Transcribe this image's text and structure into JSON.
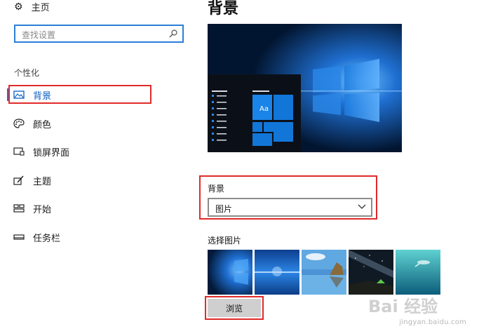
{
  "sidebar": {
    "home_label": "主页",
    "search_placeholder": "查找设置",
    "group_title": "个性化",
    "items": [
      {
        "label": "背景",
        "icon": "picture-icon",
        "active": true
      },
      {
        "label": "颜色",
        "icon": "palette-icon",
        "active": false
      },
      {
        "label": "锁屏界面",
        "icon": "lock-screen-icon",
        "active": false
      },
      {
        "label": "主题",
        "icon": "theme-brush-icon",
        "active": false
      },
      {
        "label": "开始",
        "icon": "start-grid-icon",
        "active": false
      },
      {
        "label": "任务栏",
        "icon": "taskbar-icon",
        "active": false
      }
    ]
  },
  "main": {
    "title": "背景",
    "preview_tile_text": "Aa",
    "background_label": "背景",
    "background_value": "图片",
    "choose_label": "选择图片",
    "browse_label": "浏览",
    "thumbnails": [
      "windows-hero-blue",
      "blue-horizon",
      "coastal-rock",
      "night-sky-tent",
      "underwater-swimmer"
    ]
  },
  "watermark": {
    "brand": "Bai 经验",
    "url": "jingyan.baidu.com"
  },
  "colors": {
    "accent": "#0a5ec4",
    "highlight_red": "#e12a2a",
    "search_border": "#2b7fd6"
  }
}
